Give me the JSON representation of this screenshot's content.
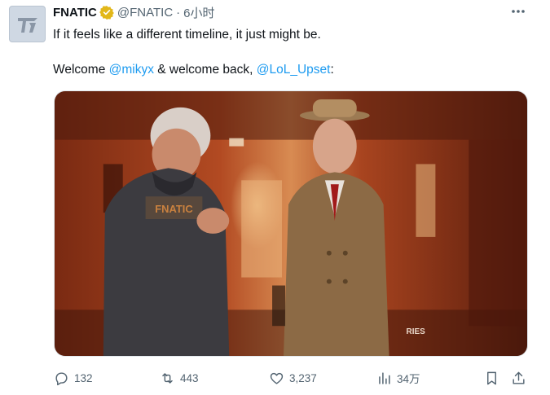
{
  "tweet": {
    "display_name": "FNATIC",
    "handle": "@FNATIC",
    "separator": "·",
    "time": "6小时",
    "text_line1": "If it feels like a different timeline, it just might be.",
    "text_line2_prefix": "Welcome ",
    "mention1": "@mikyx",
    "text_line2_middle": " & welcome back, ",
    "mention2": "@LoL_Upset",
    "text_line2_suffix": ":",
    "media_caption_sign": "RIES",
    "media_hoodie_print": "FNATIC"
  },
  "actions": {
    "reply_count": "132",
    "retweet_count": "443",
    "like_count": "3,237",
    "views_count": "34万"
  },
  "colors": {
    "accent": "#1d9bf0",
    "verified_gold": "#e2b719",
    "muted": "#536471"
  },
  "icons": {
    "avatar": "fnatic-logo-icon",
    "verified": "verified-badge-icon",
    "more": "more-dots-icon",
    "reply": "reply-icon",
    "retweet": "retweet-icon",
    "like": "heart-icon",
    "views": "views-chart-icon",
    "bookmark": "bookmark-icon",
    "share": "share-icon"
  }
}
